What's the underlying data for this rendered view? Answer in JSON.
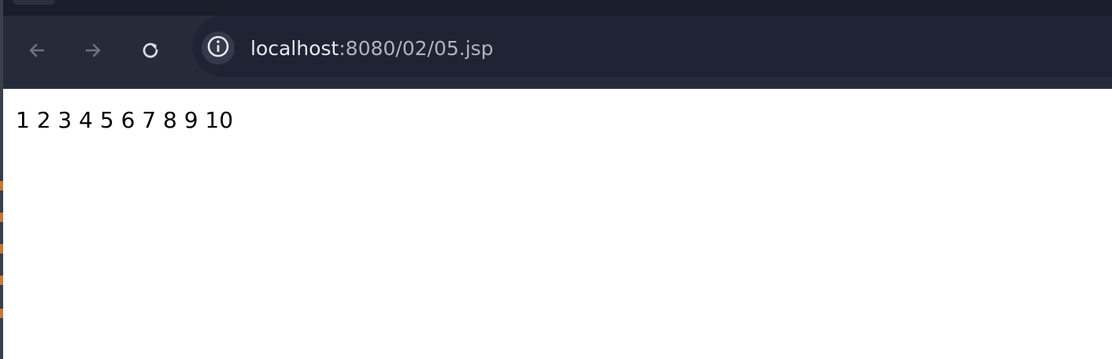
{
  "browser": {
    "toolbar": {
      "back_icon": "arrow-left-icon",
      "forward_icon": "arrow-right-icon",
      "reload_icon": "reload-icon",
      "site_info_icon": "info-circle-icon"
    },
    "address_bar": {
      "host": "localhost",
      "path": ":8080/02/05.jsp"
    }
  },
  "page": {
    "output_text": "1 2 3 4 5 6 7 8 9 10"
  },
  "colors": {
    "tabstrip": "#1a1e2b",
    "toolbar": "#262b3a",
    "omnibox": "#1f2434",
    "page_background": "#ffffff"
  }
}
